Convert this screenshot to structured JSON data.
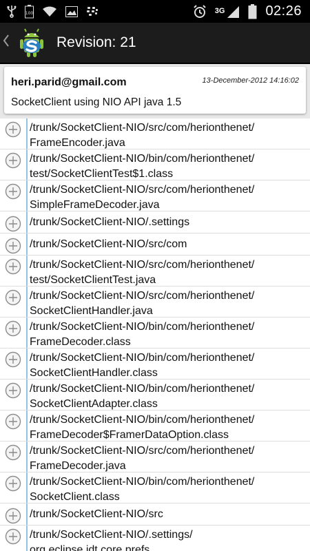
{
  "status_bar": {
    "time": "02:26",
    "network": "3G",
    "icons_left": [
      "usb-icon",
      "battery-100-icon",
      "wifi-icon",
      "image-icon",
      "bbm-icon"
    ],
    "icons_right": [
      "alarm-icon",
      "signal-icon",
      "battery-icon"
    ]
  },
  "action_bar": {
    "title": "Revision: 21"
  },
  "revision": {
    "author": "heri.parid@gmail.com",
    "date": "13-December-2012 14:16:02",
    "message": "SocketClient using NIO API java 1.5"
  },
  "files": [
    {
      "path": "/trunk/SocketClient-NIO/src/com/herionthenet/\nFrameEncoder.java"
    },
    {
      "path": "/trunk/SocketClient-NIO/bin/com/herionthenet/\ntest/SocketClientTest$1.class"
    },
    {
      "path": "/trunk/SocketClient-NIO/src/com/herionthenet/\nSimpleFrameDecoder.java"
    },
    {
      "path": "/trunk/SocketClient-NIO/.settings"
    },
    {
      "path": "/trunk/SocketClient-NIO/src/com"
    },
    {
      "path": "/trunk/SocketClient-NIO/src/com/herionthenet/\ntest/SocketClientTest.java"
    },
    {
      "path": "/trunk/SocketClient-NIO/src/com/herionthenet/\nSocketClientHandler.java"
    },
    {
      "path": "/trunk/SocketClient-NIO/bin/com/herionthenet/\nFrameDecoder.class"
    },
    {
      "path": "/trunk/SocketClient-NIO/bin/com/herionthenet/\nSocketClientHandler.class"
    },
    {
      "path": "/trunk/SocketClient-NIO/bin/com/herionthenet/\nSocketClientAdapter.class"
    },
    {
      "path": "/trunk/SocketClient-NIO/bin/com/herionthenet/\nFrameDecoder$FramerDataOption.class"
    },
    {
      "path": "/trunk/SocketClient-NIO/src/com/herionthenet/\nFrameDecoder.java"
    },
    {
      "path": "/trunk/SocketClient-NIO/bin/com/herionthenet/\nSocketClient.class"
    },
    {
      "path": "/trunk/SocketClient-NIO/src"
    },
    {
      "path": "/trunk/SocketClient-NIO/.settings/\norg.eclipse.jdt.core.prefs"
    }
  ],
  "colors": {
    "action_bar": "#1c1c1c",
    "divider_accent": "#8fc4e8"
  }
}
